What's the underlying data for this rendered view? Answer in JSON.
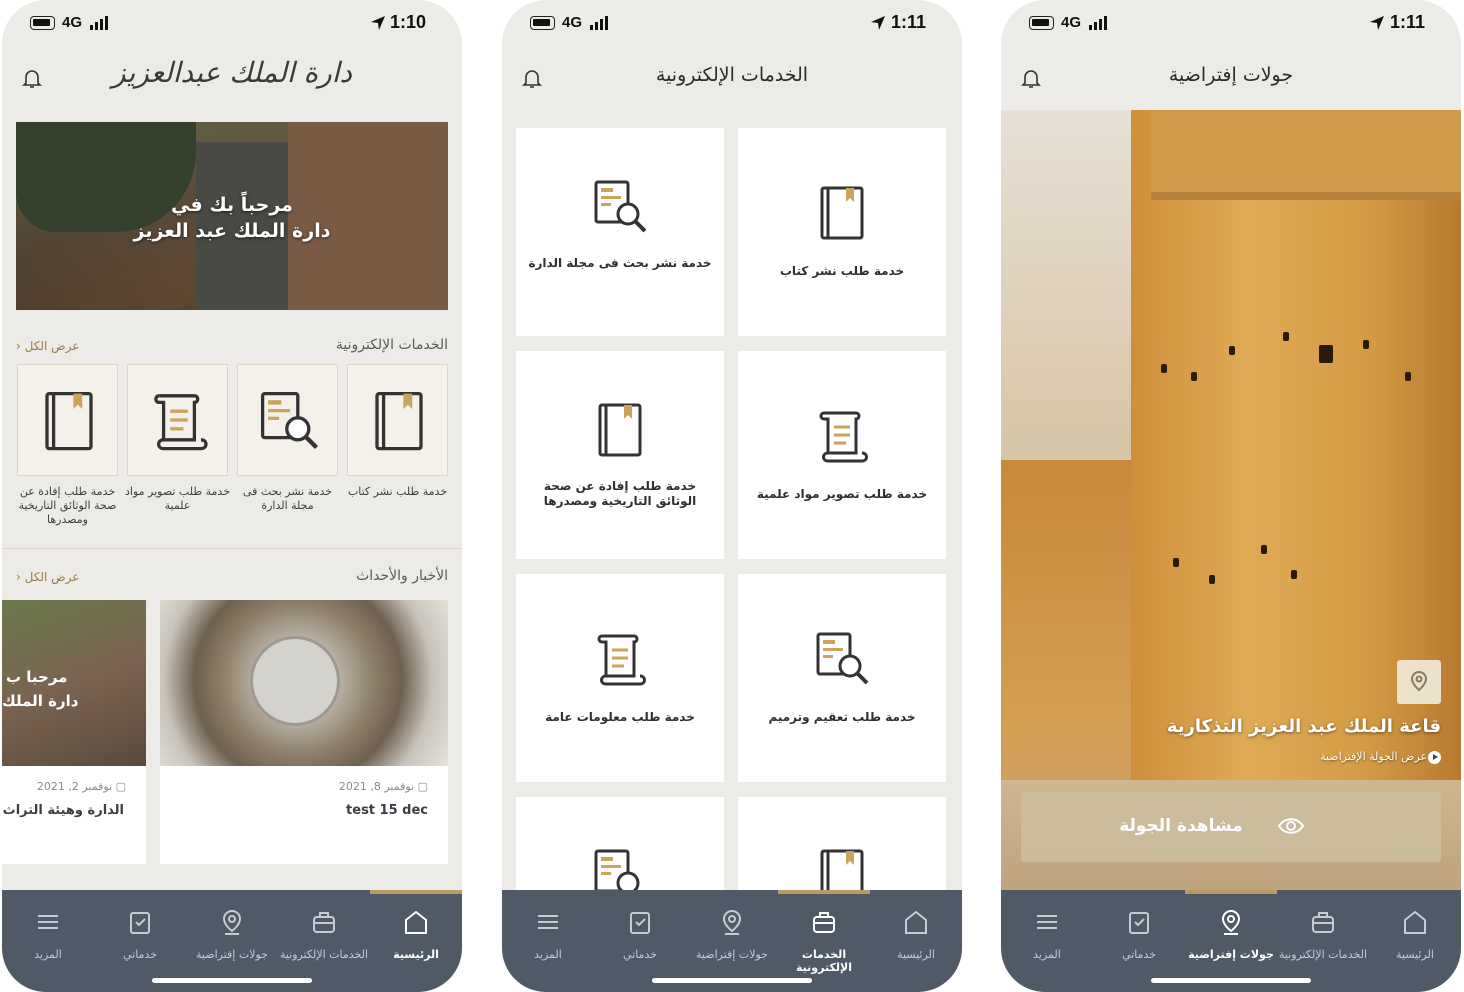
{
  "colors": {
    "accent": "#b89a62",
    "tabbar": "#4f5a66",
    "background": "#ecebe7"
  },
  "phone1": {
    "status": {
      "network": "4G",
      "time": "1:10"
    },
    "logo_text": "دارة الملك عبدالعزيز",
    "hero": {
      "line1": "مرحباً بك في",
      "line2": "دارة الملك عبد العزيز"
    },
    "services": {
      "title": "الخدمات الإلكترونية",
      "see_all": "عرض الكل",
      "items": [
        {
          "label": "خدمة طلب نشر كتاب",
          "icon": "book-icon"
        },
        {
          "label": "خدمة نشر بحث فى مجلة الدارة",
          "icon": "document-search-icon"
        },
        {
          "label": "خدمة طلب تصوير مواد علمية",
          "icon": "scroll-icon"
        },
        {
          "label": "خدمة طلب إفادة عن صحة الوثائق التاريخية ومصدرها",
          "icon": "book-icon"
        }
      ]
    },
    "news": {
      "title": "الأخبار والأحداث",
      "see_all": "عرض الكل",
      "items": [
        {
          "date": "نوفمبر 8, 2021",
          "title": "test 15 dec",
          "image": "coins-photo"
        },
        {
          "date": "نوفمبر 2, 2021",
          "title": "الدارة وهيئة التراث تعا",
          "image_text1": "مرحبا ب",
          "image_text2": "دارة الملك"
        }
      ]
    }
  },
  "phone2": {
    "status": {
      "network": "4G",
      "time": "1:11"
    },
    "title": "الخدمات الإلكترونية",
    "cards": [
      {
        "label": "خدمة طلب نشر كتاب",
        "icon": "book-icon"
      },
      {
        "label": "خدمة نشر بحث فى مجلة الدارة",
        "icon": "document-search-icon"
      },
      {
        "label": "خدمة طلب تصوير مواد علمية",
        "icon": "scroll-icon"
      },
      {
        "label": "خدمة طلب إفادة عن صحة الوثائق التاريخية ومصدرها",
        "icon": "book-icon"
      },
      {
        "label": "خدمة طلب تعقيم وترميم",
        "icon": "document-search-icon"
      },
      {
        "label": "خدمة طلب معلومات عامة",
        "icon": "scroll-icon"
      },
      {
        "label": "",
        "icon": "book-icon"
      },
      {
        "label": "",
        "icon": "document-search-icon"
      }
    ]
  },
  "phone3": {
    "status": {
      "network": "4G",
      "time": "1:11"
    },
    "title": "جولات إفتراضية",
    "tour_title": "قاعة الملك عبد العزيز التذكارية",
    "tour_subtitle": "عرض الجولة الإفتراضية",
    "watch_label": "مشاهدة الجولة"
  },
  "tabbar": {
    "tabs": [
      {
        "label": "الرئيسية",
        "icon": "home-icon"
      },
      {
        "label": "الخدمات الإلكترونية",
        "icon": "briefcase-icon"
      },
      {
        "label": "جولات إفتراضية",
        "icon": "location-pin-icon"
      },
      {
        "label": "خدماتي",
        "icon": "clipboard-icon"
      },
      {
        "label": "المزيد",
        "icon": "menu-icon"
      }
    ]
  }
}
